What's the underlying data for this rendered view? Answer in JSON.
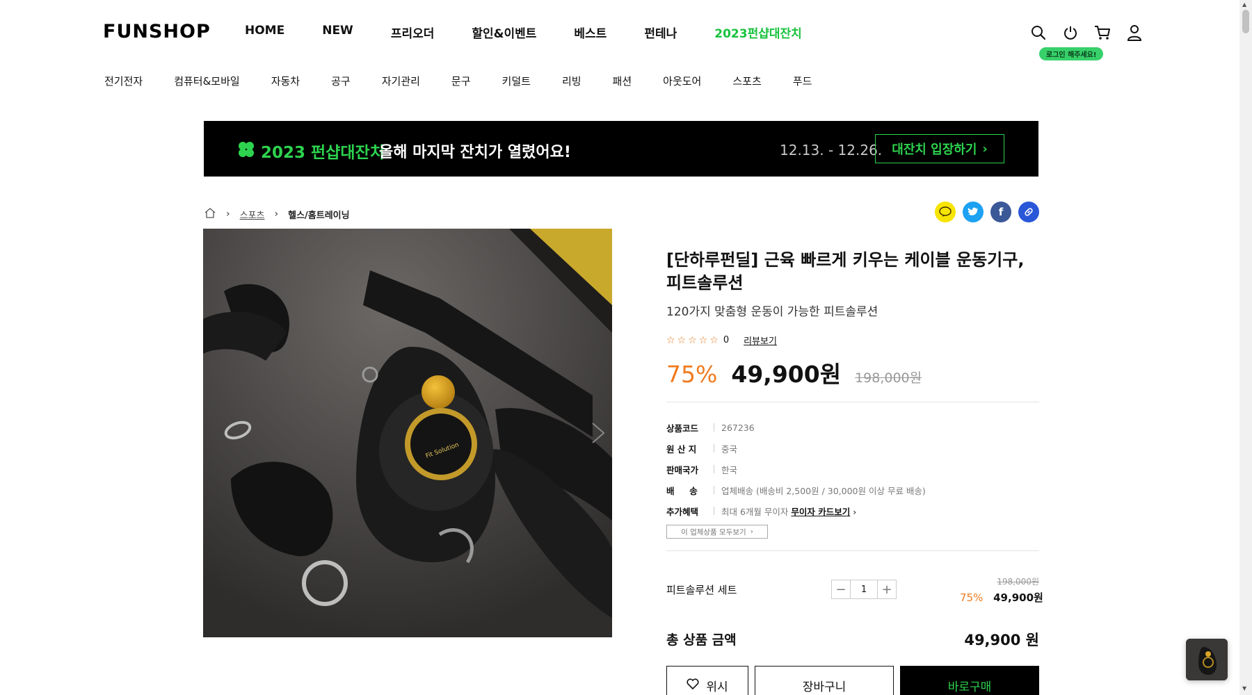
{
  "brand": "FUNSHOP",
  "nav": {
    "main": [
      "HOME",
      "NEW",
      "프리오더",
      "할인&이벤트",
      "베스트",
      "펀테나",
      "2023펀샵대잔치"
    ],
    "categories": [
      "전기전자",
      "컴퓨터&모바일",
      "자동차",
      "공구",
      "자기관리",
      "문구",
      "키덜트",
      "리빙",
      "패션",
      "아웃도어",
      "스포츠",
      "푸드"
    ],
    "login_tip": "로그인 해주세요!"
  },
  "banner": {
    "title_green": "2023 펀샵대잔치",
    "title_white": "올해 마지막 잔치가 열렸어요!",
    "dates": "12.13. - 12.26.",
    "cta": "대잔치 입장하기"
  },
  "breadcrumb": {
    "level1": "스포츠",
    "level2": "헬스/홈트레이닝"
  },
  "product": {
    "title": "[단하루펀딜] 근육 빠르게 키우는 케이블 운동기구, 피트솔루션",
    "subtitle": "120가지 맞춤형 운동이 가능한 피트솔루션",
    "review_count": "0",
    "review_link": "리뷰보기",
    "discount": "75%",
    "price": "49,900원",
    "original_price": "198,000원",
    "image_logo_text": "Fit Solution"
  },
  "meta": [
    {
      "label": "상품코드",
      "value": "267236"
    },
    {
      "label": "원 산 지",
      "value": "중국"
    },
    {
      "label": "판매국가",
      "value": "한국"
    },
    {
      "label": "배     송",
      "value": "업체배송 (배송비 2,500원 / 30,000원 이상 무료 배송)"
    },
    {
      "label": "추가혜택",
      "value": "최대 6개월 무이자",
      "link": "무이자 카드보기"
    }
  ],
  "brand_all": "이 업체상품 모두보기",
  "option": {
    "name": "피트솔루션 세트",
    "quantity": "1",
    "original": "198,000원",
    "discount": "75%",
    "price": "49,900원"
  },
  "total": {
    "label": "총 상품 금액",
    "value": "49,900 원"
  },
  "buttons": {
    "wish": "위시",
    "cart": "장바구니",
    "buy": "바로구매"
  },
  "colors": {
    "accent_green": "#2dd34e",
    "discount_orange": "#f07b1f",
    "banner_bg": "#000000"
  }
}
